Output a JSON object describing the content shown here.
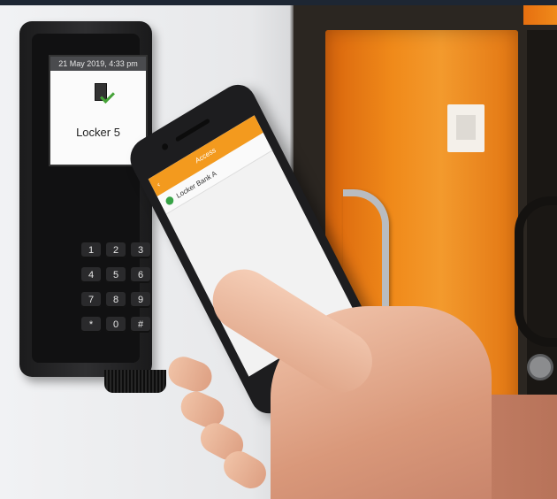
{
  "reader": {
    "date_time": "21 May 2019, 4:33 pm",
    "locker_label": "Locker 5",
    "brand": "",
    "keys": [
      "1",
      "2",
      "3",
      "4",
      "5",
      "6",
      "7",
      "8",
      "9",
      "*",
      "0",
      "#"
    ]
  },
  "phone": {
    "header_title": "Access",
    "back_icon": "chevron-left-icon",
    "list_item": "Locker Bank A"
  },
  "colors": {
    "locker_orange": "#f08a1a",
    "app_header": "#f39a1e",
    "status_green": "#38a447"
  }
}
